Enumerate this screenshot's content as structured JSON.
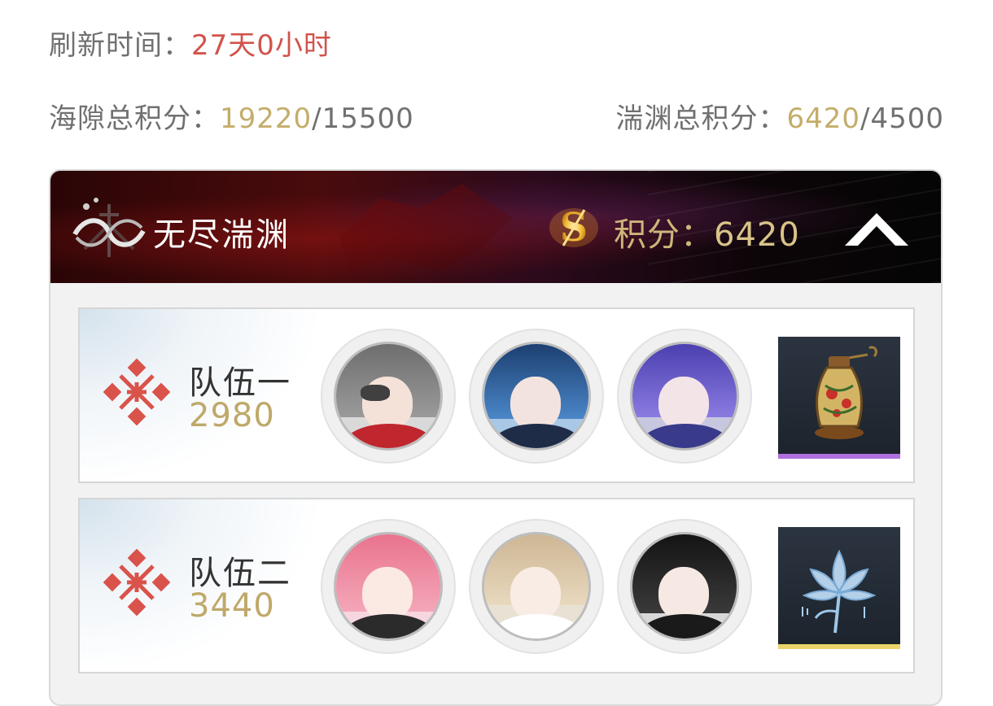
{
  "refresh": {
    "label": "刷新时间：",
    "value": "27天0小时"
  },
  "scores": {
    "left": {
      "label": "海隙总积分：",
      "current": "19220",
      "total": "/15500"
    },
    "right": {
      "label": "湍渊总积分：",
      "current": "6420",
      "total": "/4500"
    }
  },
  "panel": {
    "title": "无尽湍渊",
    "score_label": "积分：",
    "score_value": "6420",
    "emblem_icon": "abyss-emblem-icon",
    "coin_icon": "score-coin-icon",
    "collapse_icon": "chevron-up-icon"
  },
  "teams": [
    {
      "name": "队伍一",
      "score": "2980",
      "members": [
        "grey-hair-character",
        "blue-hat-character",
        "purple-hair-character"
      ],
      "item": {
        "icon": "lantern-icon",
        "rarity_color": "#b070e0"
      }
    },
    {
      "name": "队伍二",
      "score": "3440",
      "members": [
        "pink-hair-character",
        "blonde-hair-character",
        "black-hair-character"
      ],
      "item": {
        "icon": "ice-flower-icon",
        "rarity_color": "#ecd46a"
      }
    }
  ],
  "colors": {
    "accent_red": "#d2534b",
    "gold": "#c4ad6a"
  }
}
